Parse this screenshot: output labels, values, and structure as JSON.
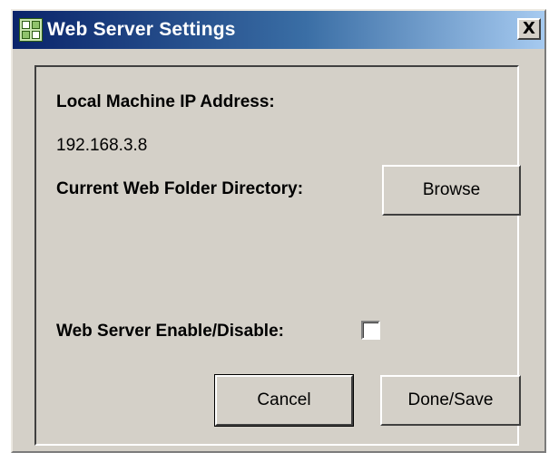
{
  "window": {
    "title": "Web Server Settings",
    "title_icon": "settings-grid-icon",
    "close_glyph": "X"
  },
  "form": {
    "ip_label": "Local Machine IP Address:",
    "ip_value": "192.168.3.8",
    "folder_label": "Current Web Folder Directory:",
    "browse_button": "Browse",
    "enable_label": "Web Server Enable/Disable:",
    "enable_checked": false
  },
  "actions": {
    "cancel": "Cancel",
    "done_save": "Done/Save"
  },
  "colors": {
    "titlebar_start": "#0a246a",
    "titlebar_end": "#a6caf0",
    "window_bg": "#d4d0c8"
  }
}
